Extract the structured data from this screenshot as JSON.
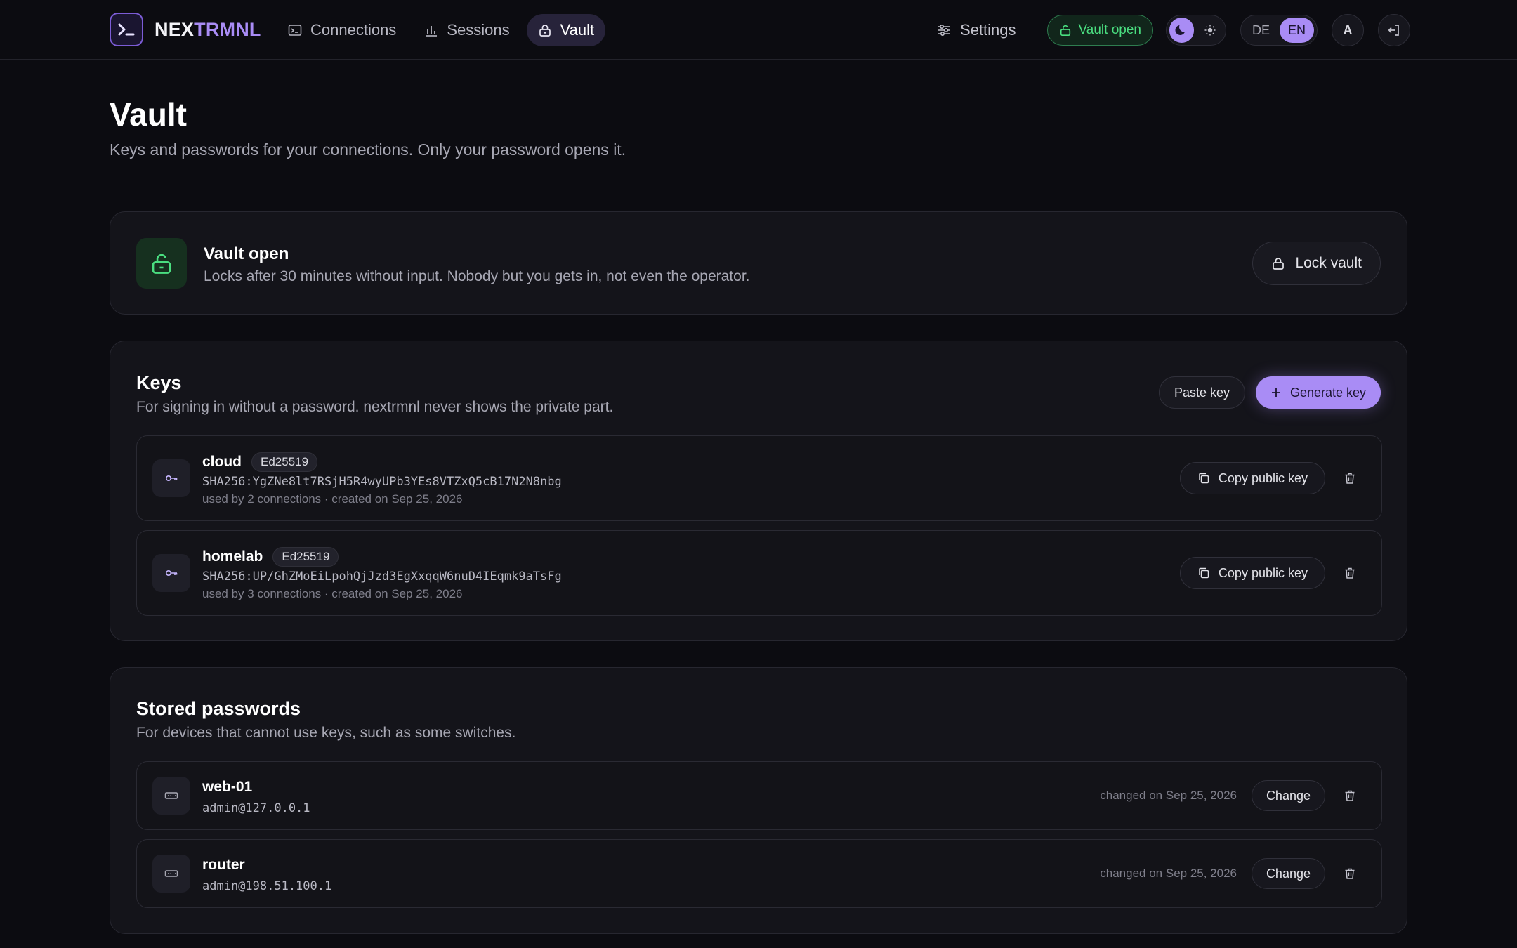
{
  "brand": {
    "name_a": "NEX",
    "name_b": "TRMNL",
    "logo_glyph": ">_"
  },
  "nav": [
    {
      "label": "Connections",
      "icon": "terminal-icon"
    },
    {
      "label": "Sessions",
      "icon": "bar-chart-icon"
    },
    {
      "label": "Vault",
      "icon": "lock-icon",
      "active": true
    }
  ],
  "toolbar": {
    "settings_label": "Settings",
    "vault_status": "Vault open",
    "theme": "dark",
    "languages": [
      "DE",
      "EN"
    ],
    "active_language": "EN",
    "avatar_initial": "A"
  },
  "page": {
    "title": "Vault",
    "subtitle": "Keys and passwords for your connections. Only your password opens it."
  },
  "status": {
    "title": "Vault open",
    "text": "Locks after 30 minutes without input. Nobody but you gets in, not even the operator.",
    "lock_label": "Lock vault"
  },
  "keys": {
    "title": "Keys",
    "subtitle": "For signing in without a password. nextrmnl never shows the private part.",
    "paste_label": "Paste key",
    "generate_label": "Generate key",
    "copy_label": "Copy public key",
    "items": [
      {
        "name": "cloud",
        "algo": "Ed25519",
        "fingerprint": "SHA256:YgZNe8lt7RSjH5R4wyUPb3YEs8VTZxQ5cB17N2N8nbg",
        "meta": "used by 2 connections · created on Sep 25, 2026"
      },
      {
        "name": "homelab",
        "algo": "Ed25519",
        "fingerprint": "SHA256:UP/GhZMoEiLpohQjJzd3EgXxqqW6nuD4IEqmk9aTsFg",
        "meta": "used by 3 connections · created on Sep 25, 2026"
      }
    ]
  },
  "passwords": {
    "title": "Stored passwords",
    "subtitle": "For devices that cannot use keys, such as some switches.",
    "change_label": "Change",
    "items": [
      {
        "name": "web-01",
        "user": "admin@127.0.0.1",
        "changed": "changed on Sep 25, 2026"
      },
      {
        "name": "router",
        "user": "admin@198.51.100.1",
        "changed": "changed on Sep 25, 2026"
      }
    ]
  },
  "colors": {
    "accent": "#a98cf5",
    "success": "#4ade80",
    "background": "#0c0c11",
    "card": "#14141a"
  }
}
